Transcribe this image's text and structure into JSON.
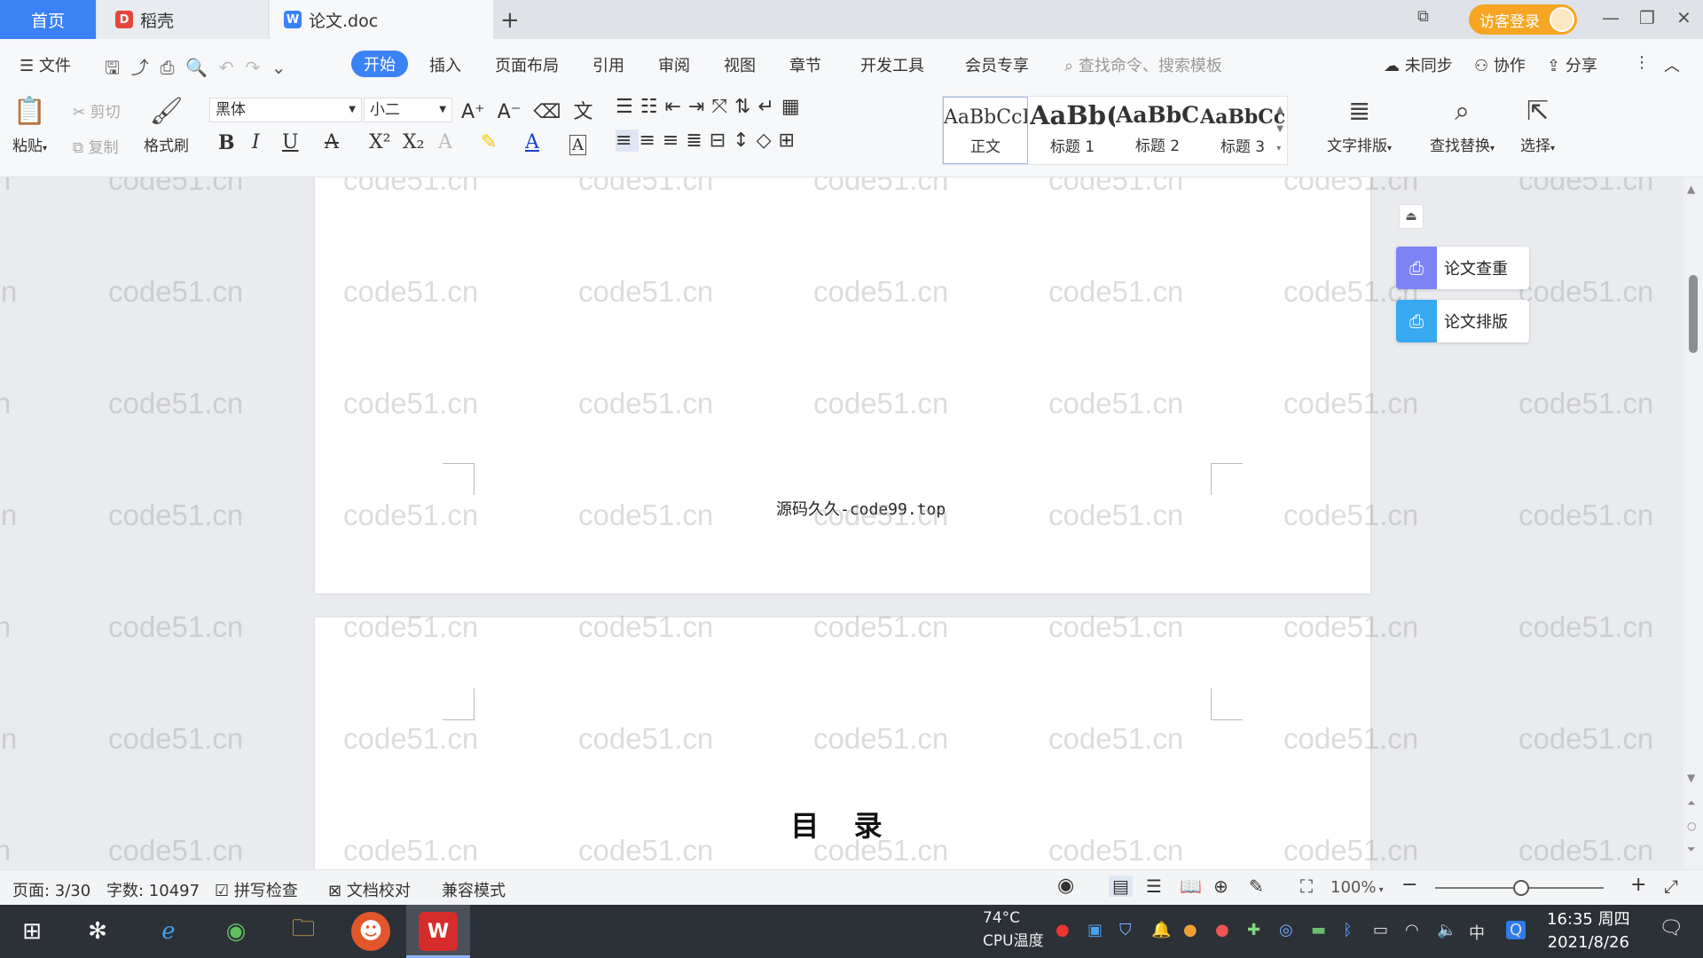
{
  "tabs": {
    "home": "首页",
    "daoke": "稻壳",
    "doc": "论文.doc"
  },
  "title_bar": {
    "login": "访客登录"
  },
  "menu": {
    "file": "文件",
    "items": [
      "开始",
      "插入",
      "页面布局",
      "引用",
      "审阅",
      "视图",
      "章节",
      "开发工具",
      "会员专享"
    ],
    "search_placeholder": "查找命令、搜索模板",
    "unsynced": "未同步",
    "collab": "协作",
    "share": "分享"
  },
  "ribbon": {
    "paste": "粘贴",
    "cut": "剪切",
    "copy": "复制",
    "format_painter": "格式刷",
    "font_name": "黑体",
    "font_size": "小二",
    "styles": [
      {
        "sample": "AaBbCcI",
        "name": "正文"
      },
      {
        "sample": "AaBb(",
        "name": "标题 1"
      },
      {
        "sample": "AaBbC",
        "name": "标题 2"
      },
      {
        "sample": "AaBbCcl",
        "name": "标题 3"
      }
    ],
    "text_layout": "文字排版",
    "find_replace": "查找替换",
    "select": "选择"
  },
  "document": {
    "footer_text": "源码久久-code99.top",
    "toc_title": "目 录"
  },
  "watermark": "code51.cn",
  "side_panel": {
    "check": "论文查重",
    "layout": "论文排版"
  },
  "status": {
    "page": "页面: 3/30",
    "words": "字数: 10497",
    "spell": "拼写检查",
    "proof": "文档校对",
    "compat": "兼容模式",
    "zoom": "100%"
  },
  "taskbar": {
    "temp_value": "74°C",
    "temp_label": "CPU温度",
    "ime": "中",
    "time": "16:35 周四",
    "date": "2021/8/26"
  },
  "colors": {
    "accent": "#3b82f6",
    "login": "#f6a623",
    "check_btn": "#7c83f5",
    "layout_btn": "#38a8f0"
  }
}
